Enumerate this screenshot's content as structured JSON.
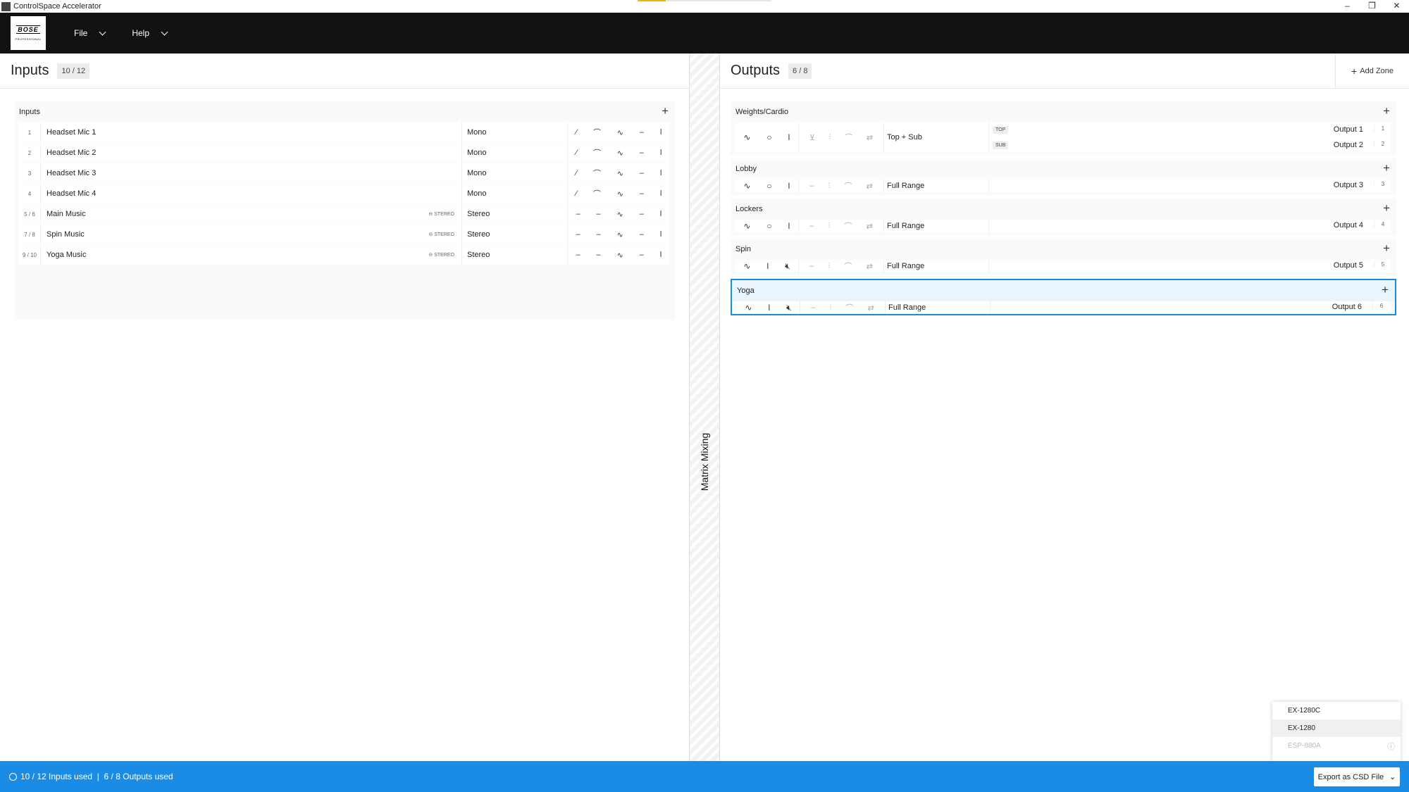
{
  "window": {
    "title": "ControlSpace Accelerator",
    "minimize": "–",
    "maximize": "❐",
    "close": "✕"
  },
  "menu": {
    "file": "File",
    "help": "Help"
  },
  "logo": {
    "brand": "BOSE",
    "sub": "PROFESSIONAL"
  },
  "inputs": {
    "title": "Inputs",
    "count": "10 / 12",
    "group_label": "Inputs",
    "add": "+",
    "rows": [
      {
        "num": "1",
        "name": "Headset Mic 1",
        "tag": "",
        "type": "Mono",
        "icons": [
          "⁄",
          "⌒",
          "∿",
          "–",
          "ǀ"
        ]
      },
      {
        "num": "2",
        "name": "Headset Mic 2",
        "tag": "",
        "type": "Mono",
        "icons": [
          "⁄",
          "⌒",
          "∿",
          "–",
          "ǀ"
        ]
      },
      {
        "num": "3",
        "name": "Headset Mic 3",
        "tag": "",
        "type": "Mono",
        "icons": [
          "⁄",
          "⌒",
          "∿",
          "–",
          "ǀ"
        ]
      },
      {
        "num": "4",
        "name": "Headset Mic 4",
        "tag": "",
        "type": "Mono",
        "icons": [
          "⁄",
          "⌒",
          "∿",
          "–",
          "ǀ"
        ]
      },
      {
        "num": "5 / 6",
        "name": "Main Music",
        "tag": "STEREO",
        "type": "Stereo",
        "icons": [
          "–",
          "–",
          "∿",
          "–",
          "ǀ"
        ]
      },
      {
        "num": "7 / 8",
        "name": "Spin Music",
        "tag": "STEREO",
        "type": "Stereo",
        "icons": [
          "–",
          "–",
          "∿",
          "–",
          "ǀ"
        ]
      },
      {
        "num": "9 / 10",
        "name": "Yoga Music",
        "tag": "STEREO",
        "type": "Stereo",
        "icons": [
          "–",
          "–",
          "∿",
          "–",
          "ǀ"
        ]
      }
    ]
  },
  "matrix_label": "Matrix Mixing",
  "outputs": {
    "title": "Outputs",
    "count": "6 / 8",
    "add_zone": "Add Zone",
    "zones": [
      {
        "name": "Weights/Cardio",
        "mode": "Top + Sub",
        "outputs": [
          {
            "tag": "TOP",
            "name": "Output 1",
            "num": "1"
          },
          {
            "tag": "SUB",
            "name": "Output 2",
            "num": "2"
          }
        ]
      },
      {
        "name": "Lobby",
        "mode": "Full Range",
        "outputs": [
          {
            "tag": "",
            "name": "Output 3",
            "num": "3"
          }
        ]
      },
      {
        "name": "Lockers",
        "mode": "Full Range",
        "outputs": [
          {
            "tag": "",
            "name": "Output 4",
            "num": "4"
          }
        ]
      },
      {
        "name": "Spin",
        "mode": "Full Range",
        "outputs": [
          {
            "tag": "",
            "name": "Output 5",
            "num": "5"
          }
        ]
      },
      {
        "name": "Yoga",
        "mode": "Full Range",
        "outputs": [
          {
            "tag": "",
            "name": "Output 6",
            "num": "6"
          }
        ]
      }
    ]
  },
  "status": {
    "text": "10 / 12 Inputs used  |  6 / 8 Outputs used",
    "export": "Export as CSD File"
  },
  "dropdown": {
    "options": [
      "EX-1280C",
      "EX-1280",
      "ESP-880A"
    ]
  }
}
